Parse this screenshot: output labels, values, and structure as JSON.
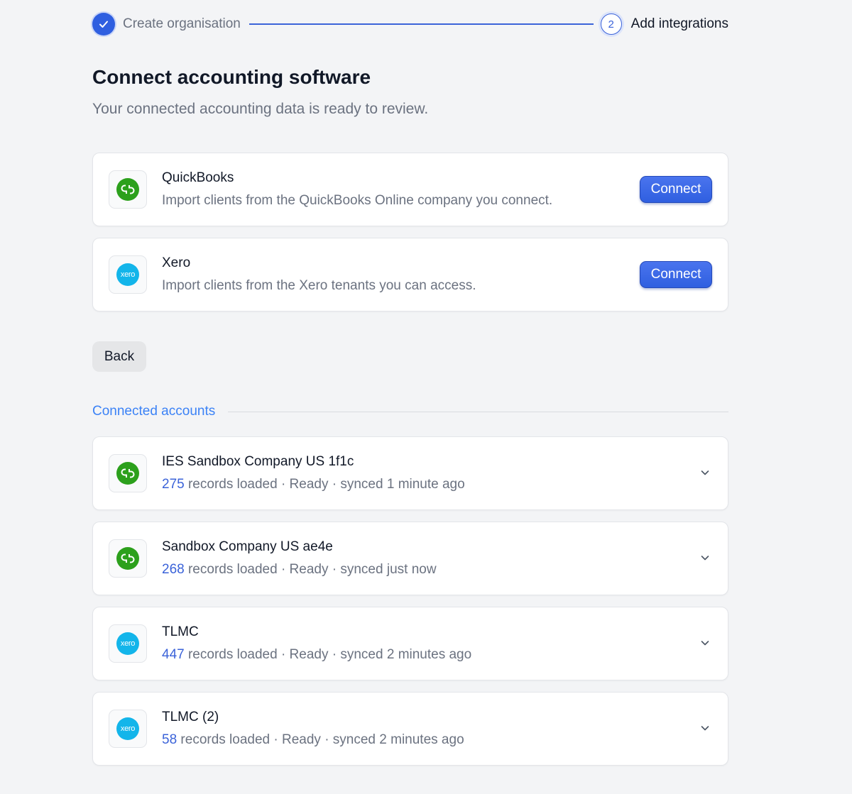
{
  "stepper": {
    "step1_label": "Create organisation",
    "step2_number": "2",
    "step2_label": "Add integrations"
  },
  "header": {
    "title": "Connect accounting software",
    "subtitle": "Your connected accounting data is ready to review."
  },
  "providers": [
    {
      "name": "QuickBooks",
      "description": "Import clients from the QuickBooks Online company you connect.",
      "logo_icon": "quickbooks-logo",
      "button_label": "Connect"
    },
    {
      "name": "Xero",
      "description": "Import clients from the Xero tenants you can access.",
      "logo_icon": "xero-logo",
      "logo_text": "xero",
      "button_label": "Connect"
    }
  ],
  "back_label": "Back",
  "connected_section_label": "Connected accounts",
  "accounts": [
    {
      "name": "IES Sandbox Company US 1f1c",
      "count": "275",
      "status": " records loaded · Ready · synced 1 minute ago",
      "provider": "quickbooks"
    },
    {
      "name": "Sandbox Company US ae4e",
      "count": "268",
      "status": " records loaded · Ready · synced just now",
      "provider": "quickbooks"
    },
    {
      "name": "TLMC",
      "count": "447",
      "status": " records loaded · Ready · synced 2 minutes ago",
      "provider": "xero",
      "logo_text": "xero"
    },
    {
      "name": "TLMC (2)",
      "count": "58",
      "status": " records loaded · Ready · synced 2 minutes ago",
      "provider": "xero",
      "logo_text": "xero"
    }
  ],
  "colors": {
    "accent": "#2f5fe0",
    "quickbooks_green": "#2ca01c",
    "xero_blue": "#13b5ea",
    "link_blue": "#3b82f6"
  }
}
